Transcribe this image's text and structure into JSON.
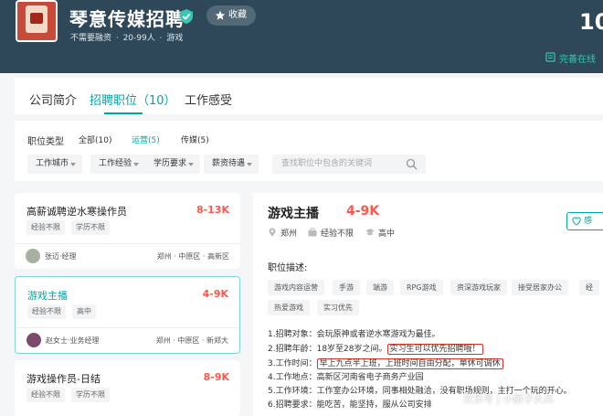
{
  "company": {
    "name": "琴意传媒招聘",
    "favorite_label": "收藏",
    "meta": "不需要融资 · 20-99人 · 游戏",
    "job_count": "10",
    "perfect_link": "完善在线"
  },
  "tabs": [
    {
      "label": "公司简介",
      "active": false
    },
    {
      "label": "招聘职位（10）",
      "active": true
    },
    {
      "label": "工作感受",
      "active": false
    }
  ],
  "filters": {
    "type_label": "职位类型",
    "chips": [
      {
        "label": "全部(10)",
        "active": false
      },
      {
        "label": "运营(5)",
        "active": true
      },
      {
        "label": "传媒(5)",
        "active": false
      }
    ],
    "selects": [
      "工作城市",
      "工作经验",
      "学历要求",
      "薪资待遇"
    ],
    "search_placeholder": "查找职位中包含的关键词"
  },
  "jobs": [
    {
      "title": "高薪诚聘逆水寒操作员",
      "salary": "8-13K",
      "tags": [
        "经验不限",
        "学历不限"
      ],
      "recruiter": "张迈·经理",
      "location": "郑州 · 中原区 · 高新区",
      "active": false
    },
    {
      "title": "游戏主播",
      "salary": "4-9K",
      "tags": [
        "经验不限",
        "高中"
      ],
      "recruiter": "赵女士·业务经理",
      "location": "郑州 · 中原区 · 新郑大",
      "active": true
    },
    {
      "title": "游戏操作员-日结",
      "salary": "8-9K",
      "tags": [
        "经验不限",
        "学历不限"
      ],
      "active": false
    }
  ],
  "detail": {
    "title": "游戏主播",
    "salary": "4-9K",
    "city": "郑州",
    "experience": "经验不限",
    "education": "高中",
    "interest_label": "感",
    "desc_heading": "职位描述:",
    "keywords": [
      "游戏内容运营",
      "手游",
      "端游",
      "RPG游戏",
      "资深游戏玩家",
      "接受居家办公",
      "经",
      "热爱游戏",
      "实习优先"
    ],
    "lines": {
      "l1": "1.招聘对象：会玩原神或者逆水寒游戏为最佳。",
      "l2_pre": "2.招聘年龄：18岁至28岁之间。",
      "l2_hl": "实习生可以优先招聘哦！",
      "l3_pre": "3.工作时间：",
      "l3_hl": "早上九点半上班，上班时间自由分配，单休可调休",
      "l4": "4.工作地点：高新区河南省电子商务产业园",
      "l5": "5.工作环境：工作室办公环境，同事相处融洽，没有职场规则，主打一个玩的开心。",
      "l6": "6.招聘要求：能吃苦，能坚持，服从公司安排"
    }
  },
  "watermark": "欢乐号 | 小厨子大兵",
  "colors": {
    "header_bg": "#2f4859",
    "accent": "#00a6a7",
    "salary": "#fe574a",
    "highlight_box": "#d9342b"
  }
}
